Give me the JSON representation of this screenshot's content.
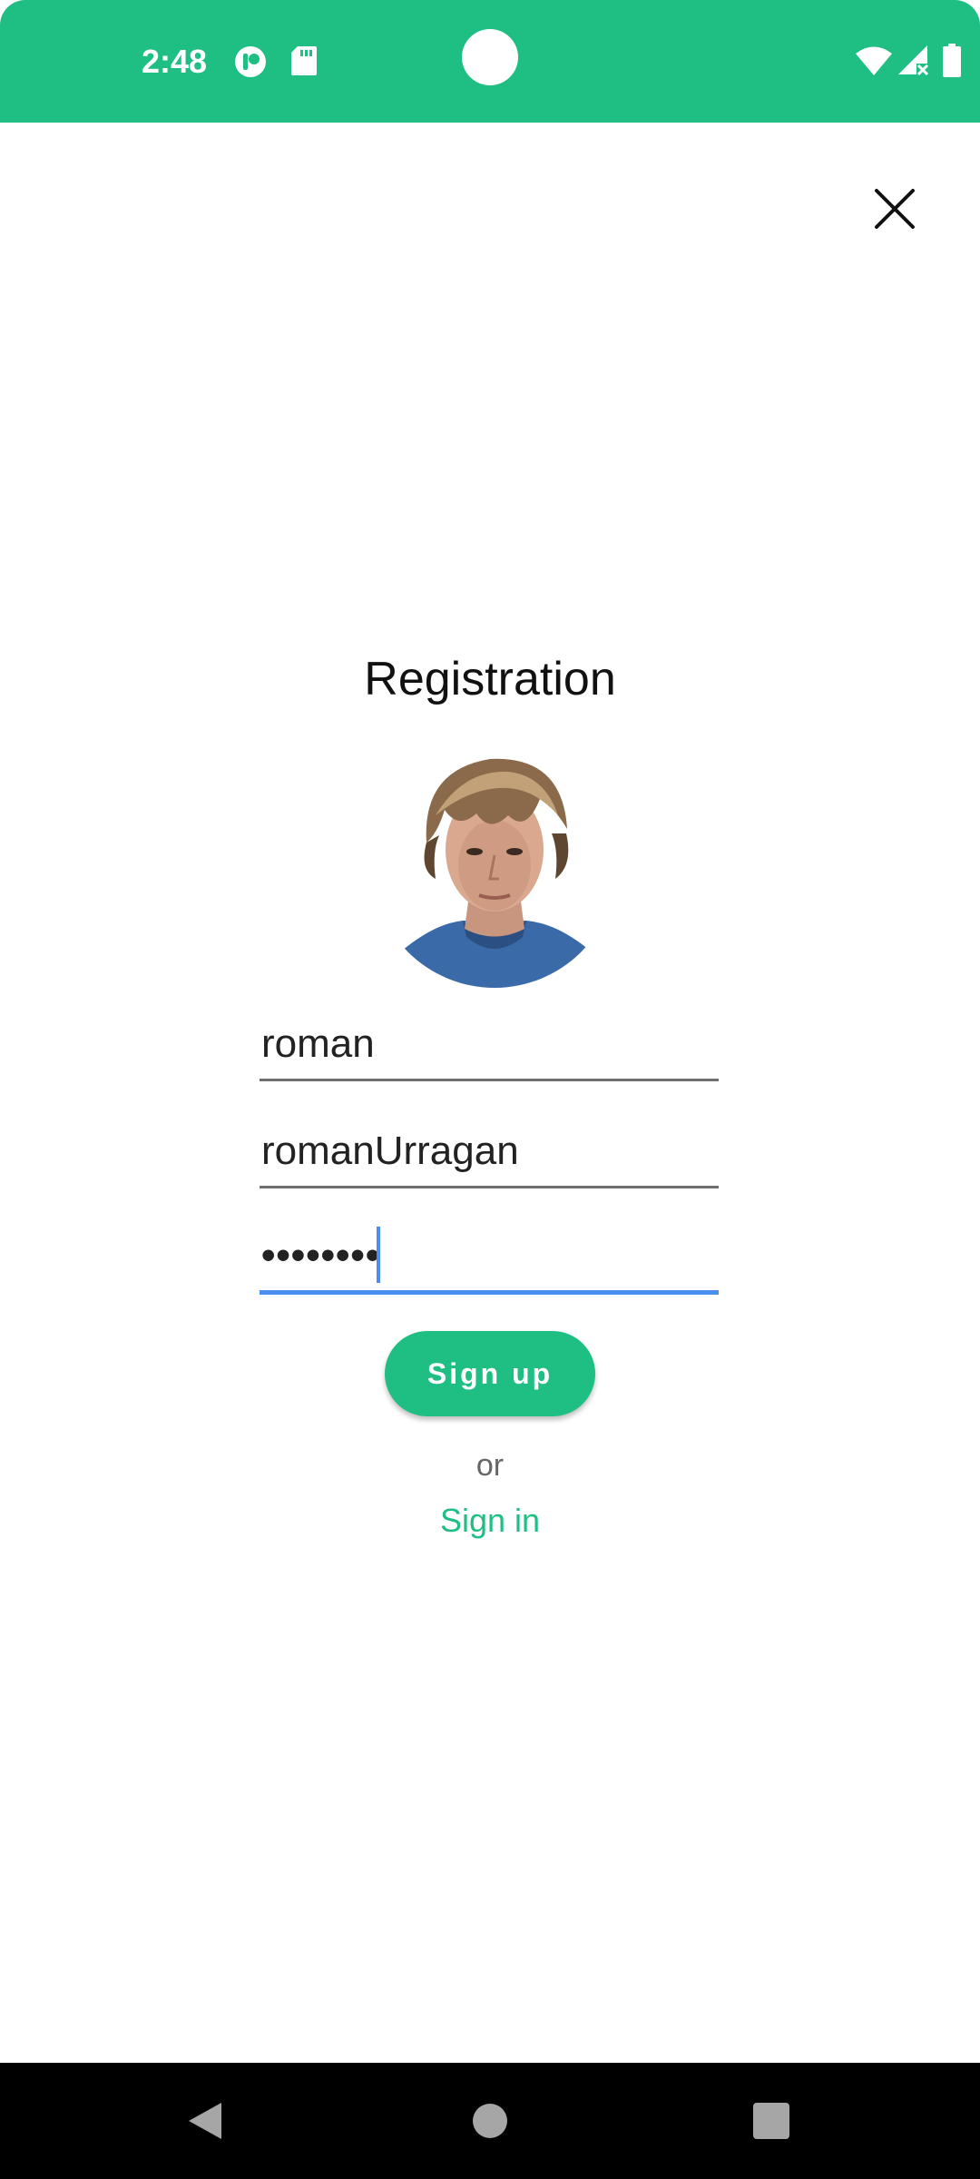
{
  "status_bar": {
    "time": "2:48",
    "left_icons": [
      "app-indicator-icon",
      "sd-card-icon"
    ],
    "right_icons": [
      "wifi-icon",
      "signal-no-service-icon",
      "battery-icon"
    ],
    "background_color": "#1fbf84"
  },
  "header": {
    "close_icon": "close-icon"
  },
  "registration": {
    "title": "Registration",
    "avatar": "profile-photo",
    "fields": {
      "name_value": "roman",
      "username_value": "romanUrragan",
      "password_value": "••••••••"
    },
    "signup_label": "Sign up",
    "or_label": "or",
    "signin_label": "Sign in"
  },
  "colors": {
    "accent": "#1fbf84",
    "focus": "#4a8ff0"
  },
  "nav_bar": {
    "back_icon": "back-triangle-icon",
    "home_icon": "home-circle-icon",
    "recents_icon": "recents-square-icon"
  }
}
